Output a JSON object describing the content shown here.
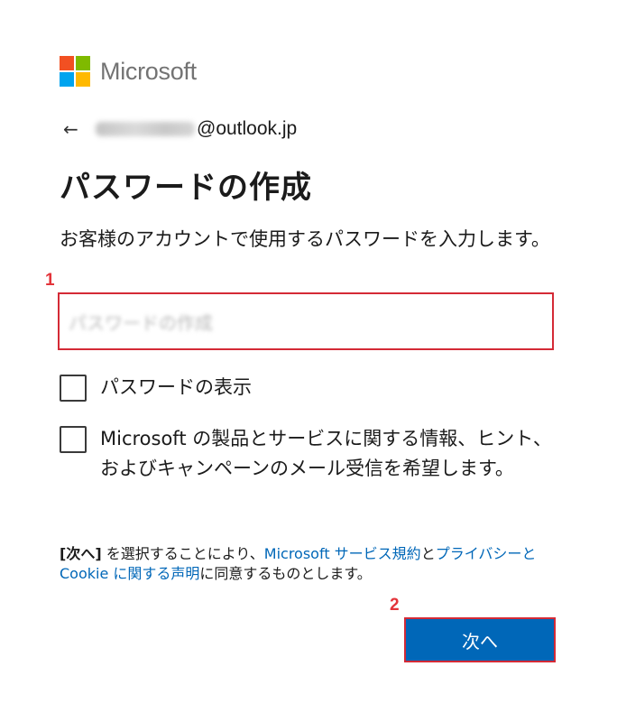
{
  "brand": {
    "name": "Microsoft",
    "logo_colors": [
      "#f25022",
      "#7fba00",
      "#00a4ef",
      "#ffb900"
    ]
  },
  "identity": {
    "back_icon": "←",
    "email_blurred": "Word0011",
    "email_domain": "@outlook.jp"
  },
  "page": {
    "title": "パスワードの作成",
    "description": "お客様のアカウントで使用するパスワードを入力します。"
  },
  "annotations": {
    "marker_1": "1",
    "marker_2": "2",
    "marker_color": "#e3343a"
  },
  "password_field": {
    "placeholder": "パスワードの作成"
  },
  "options": {
    "show_password_label": "パスワードの表示",
    "marketing_label": "Microsoft の製品とサービスに関する情報、ヒント、およびキャンペーンのメール受信を希望します。"
  },
  "legal": {
    "next_bracket": "[次へ]",
    "text_1": " を選択することにより、",
    "link_terms": "Microsoft サービス規約",
    "text_2": "と",
    "link_privacy": "プライバシーと Cookie に関する声明",
    "text_3": "に同意するものとします。"
  },
  "actions": {
    "next_label": "次へ",
    "accent_color": "#0067b8"
  }
}
